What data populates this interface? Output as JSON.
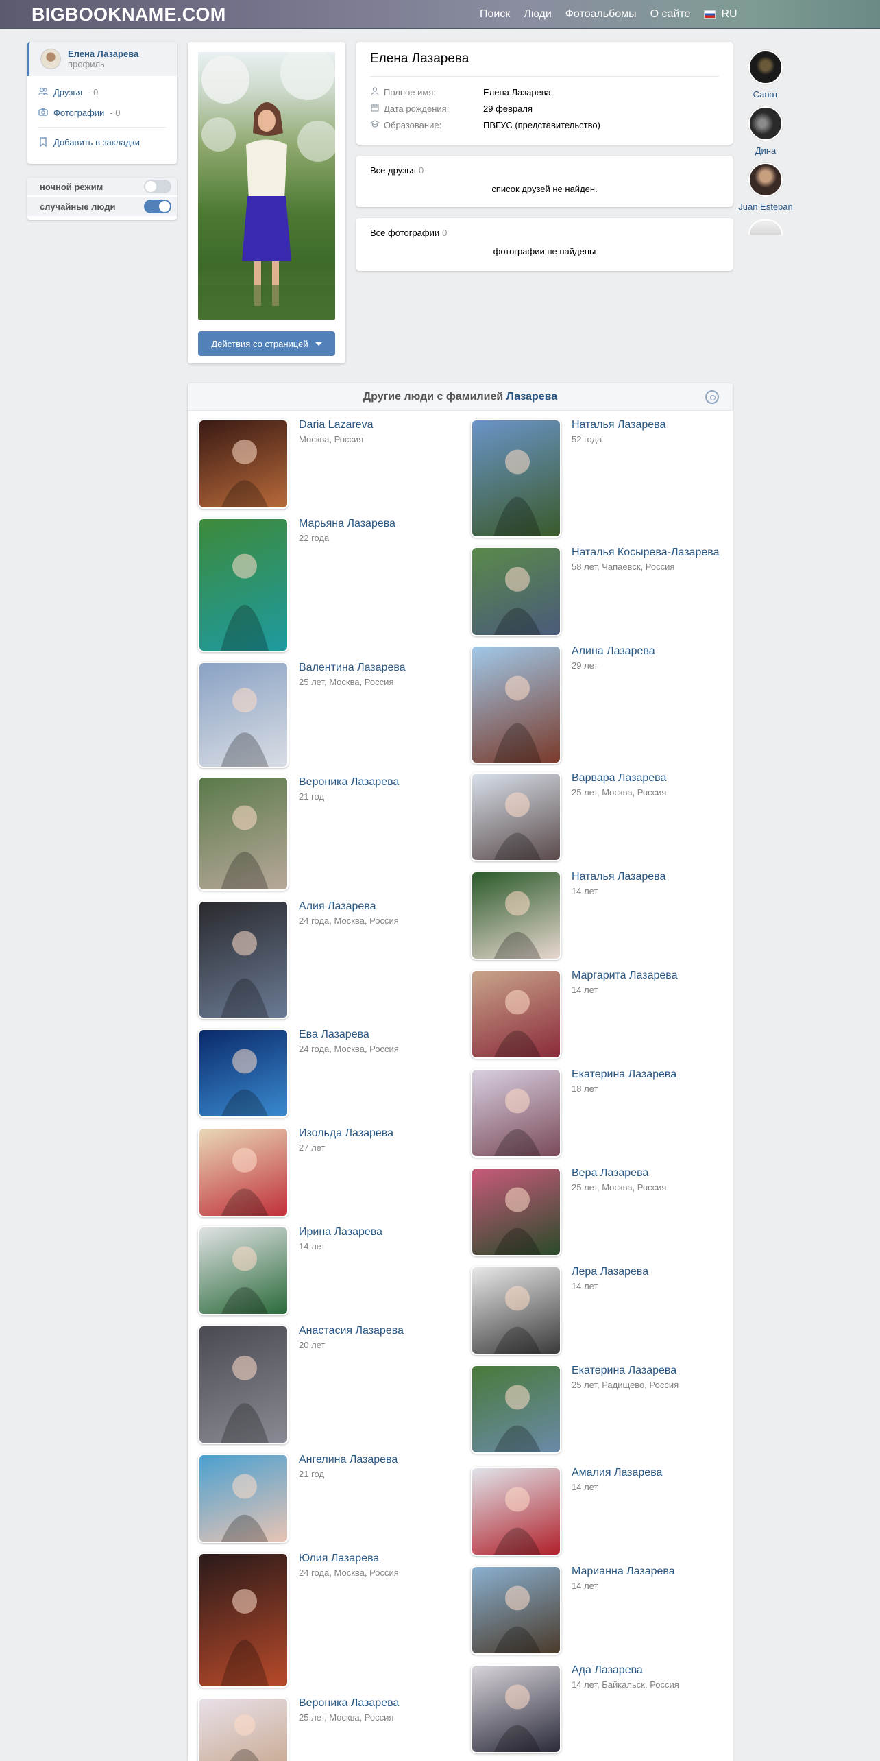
{
  "header": {
    "logo": "BIGBOOKNAME.COM",
    "nav": [
      "Поиск",
      "Люди",
      "Фотоальбомы",
      "О сайте"
    ],
    "lang": "RU"
  },
  "sidebar": {
    "user_name": "Елена Лазарева",
    "user_sub": "профиль",
    "friends_label": "Друзья",
    "friends_count": "- 0",
    "photos_label": "Фотографии",
    "photos_count": "- 0",
    "bookmark_label": "Добавить в закладки",
    "night_mode_label": "ночной режим",
    "night_mode_on": false,
    "random_people_label": "случайные люди",
    "random_people_on": true
  },
  "profile": {
    "actions_button": "Действия со страницей",
    "name": "Елена Лазарева",
    "fields": [
      {
        "key": "Полное имя:",
        "value": "Елена Лазарева",
        "icon": "person-icon"
      },
      {
        "key": "Дата рождения:",
        "value": "29 февраля",
        "icon": "calendar-icon"
      },
      {
        "key": "Образование:",
        "value": "ПВГУС (представительство)",
        "icon": "graduation-cap-icon"
      }
    ],
    "friends_title": "Все друзья",
    "friends_count": "0",
    "friends_empty": "список друзей не найден.",
    "photos_title": "Все фотографии",
    "photos_count": "0",
    "photos_empty": "фотографии не найдены"
  },
  "suggested": [
    {
      "name": "Санат",
      "color": "#2b2b2b"
    },
    {
      "name": "Дина",
      "color": "#3a3a3a"
    },
    {
      "name": "Juan Esteban",
      "color": "#4a3a36"
    }
  ],
  "others": {
    "title_prefix": "Другие люди с фамилией",
    "title_surname": "Лазарева",
    "left": [
      {
        "name": "Daria Lazareva",
        "meta": "Москва, Россия",
        "color1": "#3a1a14",
        "color2": "#b86a3a"
      },
      {
        "name": "Марьяна Лазарева",
        "meta": "22 года",
        "color1": "#3d8a3a",
        "color2": "#1e9aa0"
      },
      {
        "name": "Валентина Лазарева",
        "meta": "25 лет, Москва, Россия",
        "color1": "#8aa2c4",
        "color2": "#d9dde4"
      },
      {
        "name": "Вероника Лазарева",
        "meta": "21 год",
        "color1": "#5a7a4a",
        "color2": "#b8a89a"
      },
      {
        "name": "Алия Лазарева",
        "meta": "24 года, Москва, Россия",
        "color1": "#2a2a2e",
        "color2": "#6a7a94"
      },
      {
        "name": "Ева Лазарева",
        "meta": "24 года, Москва, Россия",
        "color1": "#0a2a6a",
        "color2": "#3a8ad0"
      },
      {
        "name": "Изольда Лазарева",
        "meta": "27 лет",
        "color1": "#e8d8b8",
        "color2": "#c0303a"
      },
      {
        "name": "Ирина Лазарева",
        "meta": "14 лет",
        "color1": "#e0e2e4",
        "color2": "#2a6a3a"
      },
      {
        "name": "Анастасия Лазарева",
        "meta": "20 лет",
        "color1": "#4a4a52",
        "color2": "#8a8a94"
      },
      {
        "name": "Ангелина Лазарева",
        "meta": "21 год",
        "color1": "#4aa0d0",
        "color2": "#e8c4b4"
      },
      {
        "name": "Юлия Лазарева",
        "meta": "24 года, Москва, Россия",
        "color1": "#2a1a1a",
        "color2": "#b84a2a"
      },
      {
        "name": "Вероника Лазарева",
        "meta": "25 лет, Москва, Россия",
        "color1": "#e8e0e8",
        "color2": "#c8a890"
      }
    ],
    "right": [
      {
        "name": "Наталья Лазарева",
        "meta": "52 года",
        "color1": "#6a94c8",
        "color2": "#3a5a2a"
      },
      {
        "name": "Наталья Косырева-Лазарева",
        "meta": "58 лет, Чапаевск, Россия",
        "color1": "#5a8a4a",
        "color2": "#4a5a7a"
      },
      {
        "name": "Алина Лазарева",
        "meta": "29 лет",
        "color1": "#a0c8e8",
        "color2": "#7a3a2a"
      },
      {
        "name": "Варвара Лазарева",
        "meta": "25 лет, Москва, Россия",
        "color1": "#d8e0ea",
        "color2": "#5a4a4a"
      },
      {
        "name": "Наталья Лазарева",
        "meta": "14 лет",
        "color1": "#2a5a2a",
        "color2": "#e8d8d0"
      },
      {
        "name": "Маргарита Лазарева",
        "meta": "14 лет",
        "color1": "#c8a48a",
        "color2": "#8a2a3a"
      },
      {
        "name": "Екатерина Лазарева",
        "meta": "18 лет",
        "color1": "#d8d0e0",
        "color2": "#7a4a5a"
      },
      {
        "name": "Вера Лазарева",
        "meta": "25 лет, Москва, Россия",
        "color1": "#c85a7a",
        "color2": "#2a4a2a"
      },
      {
        "name": "Лера Лазарева",
        "meta": "14 лет",
        "color1": "#e8e8e8",
        "color2": "#3a3a3a"
      },
      {
        "name": "Екатерина Лазарева",
        "meta": "25 лет, Радищево, Россия",
        "color1": "#4a7a3a",
        "color2": "#6a8aa8"
      },
      {
        "name": "Амалия Лазарева",
        "meta": "14 лет",
        "color1": "#e0e4ea",
        "color2": "#b0202a"
      },
      {
        "name": "Марианна Лазарева",
        "meta": "14 лет",
        "color1": "#8ab0d0",
        "color2": "#4a3a2a"
      },
      {
        "name": "Ада Лазарева",
        "meta": "14 лет, Байкальск, Россия",
        "color1": "#d8d4da",
        "color2": "#2a2a3a"
      }
    ]
  }
}
